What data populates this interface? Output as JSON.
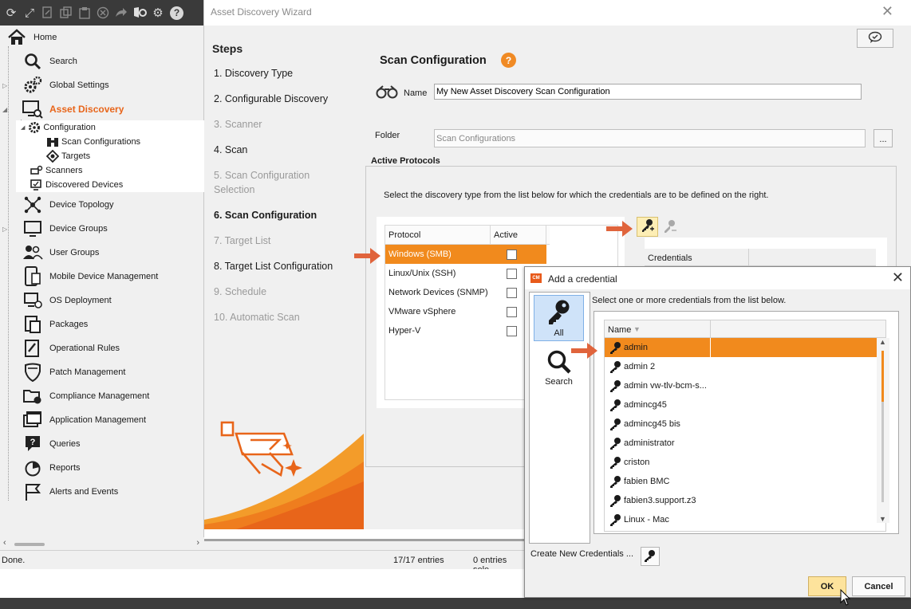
{
  "toolbar": {
    "icons": [
      "refresh-icon",
      "fullscreen-icon",
      "export-icon",
      "copy-icon",
      "clipboard-icon",
      "cancel-icon",
      "forward-icon",
      "shield-settings-icon",
      "gear-icon",
      "help-icon"
    ],
    "help_label": "?"
  },
  "nav": {
    "home": "Home",
    "items": [
      {
        "label": "Search",
        "icon": "search-icon"
      },
      {
        "label": "Global Settings",
        "icon": "gears-icon"
      },
      {
        "label": "Asset Discovery",
        "icon": "monitor-search-icon",
        "active": true
      },
      {
        "label": "Device Topology",
        "icon": "topology-icon"
      },
      {
        "label": "Device Groups",
        "icon": "monitor-group-icon"
      },
      {
        "label": "User Groups",
        "icon": "users-icon"
      },
      {
        "label": "Mobile Device Management",
        "icon": "mobile-icon"
      },
      {
        "label": "OS Deployment",
        "icon": "os-deploy-icon"
      },
      {
        "label": "Packages",
        "icon": "packages-icon"
      },
      {
        "label": "Operational Rules",
        "icon": "rules-icon"
      },
      {
        "label": "Patch Management",
        "icon": "shield-icon"
      },
      {
        "label": "Compliance Management",
        "icon": "compliance-icon"
      },
      {
        "label": "Application Management",
        "icon": "app-window-icon"
      },
      {
        "label": "Queries",
        "icon": "query-icon"
      },
      {
        "label": "Reports",
        "icon": "report-icon"
      },
      {
        "label": "Alerts and Events",
        "icon": "flag-icon"
      }
    ],
    "sub": {
      "configuration": "Configuration",
      "scan_configurations": "Scan Configurations",
      "targets": "Targets",
      "scanners": "Scanners",
      "discovered_devices": "Discovered Devices"
    }
  },
  "wizard": {
    "title": "Asset Discovery Wizard",
    "close": "✕",
    "steps_title": "Steps",
    "steps": [
      {
        "label": "1. Discovery Type",
        "state": "enabled"
      },
      {
        "label": "2. Configurable Discovery",
        "state": "enabled"
      },
      {
        "label": "3. Scanner",
        "state": "disabled"
      },
      {
        "label": "4. Scan",
        "state": "enabled"
      },
      {
        "label": "5. Scan Configuration Selection",
        "state": "disabled"
      },
      {
        "label": "6. Scan Configuration",
        "state": "current"
      },
      {
        "label": "7. Target List",
        "state": "disabled"
      },
      {
        "label": "8. Target List Configuration",
        "state": "enabled"
      },
      {
        "label": "9. Schedule",
        "state": "disabled"
      },
      {
        "label": "10. Automatic Scan",
        "state": "disabled"
      }
    ],
    "section_title": "Scan Configuration",
    "help_badge": "?",
    "name_label": "Name",
    "name_value": "My New Asset Discovery Scan Configuration",
    "folder_label": "Folder",
    "folder_value": "Scan Configurations",
    "folder_button": "...",
    "active_protocols_title": "Active Protocols",
    "active_protocols_desc": "Select the discovery type from the list below for which the credentials are to be defined on the right.",
    "protocol_headers": {
      "protocol": "Protocol",
      "active": "Active"
    },
    "protocols": [
      {
        "name": "Windows (SMB)",
        "active": true,
        "selected": true
      },
      {
        "name": "Linux/Unix (SSH)",
        "active": false
      },
      {
        "name": "Network Devices (SNMP)",
        "active": false
      },
      {
        "name": "VMware vSphere",
        "active": false
      },
      {
        "name": "Hyper-V",
        "active": false
      }
    ],
    "credentials_header": "Credentials",
    "accent": "#f18a1d"
  },
  "dialog": {
    "title": "Add a credential",
    "logo": "CM",
    "close": "✕",
    "categories": [
      {
        "label": "All",
        "icon": "key-icon",
        "selected": true
      },
      {
        "label": "Search",
        "icon": "search-icon",
        "selected": false
      }
    ],
    "instruction": "Select one or more credentials from the list below.",
    "list_header": "Name",
    "credentials": [
      {
        "name": "admin",
        "selected": true
      },
      {
        "name": "admin 2"
      },
      {
        "name": "admin vw-tlv-bcm-s..."
      },
      {
        "name": "admincg45"
      },
      {
        "name": "admincg45 bis"
      },
      {
        "name": "administrator"
      },
      {
        "name": "criston"
      },
      {
        "name": "fabien BMC"
      },
      {
        "name": "fabien3.support.z3"
      },
      {
        "name": "Linux - Mac"
      }
    ],
    "create_label": "Create New Credentials ...",
    "ok": "OK",
    "cancel": "Cancel"
  },
  "status": {
    "text": "Done.",
    "entries": "17/17 entries",
    "entries_selected": "0 entries sele"
  }
}
